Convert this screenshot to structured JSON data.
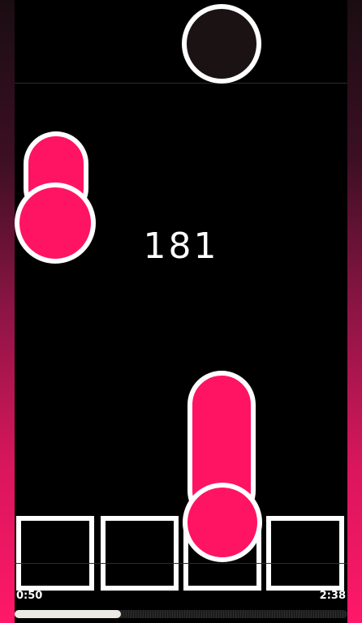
{
  "game": {
    "score": "181",
    "elapsed_time": "0:50",
    "total_time": "2:38",
    "progress": 0.32,
    "lanes": 4
  },
  "colors": {
    "note": "#ff1464",
    "note_outline": "#ffffff",
    "top_ball": "#1b1213",
    "background": "#000000",
    "gutter_bottom": "#ff1867"
  },
  "notes": [
    {
      "lane": 1,
      "type": "hold-note"
    },
    {
      "lane": 3,
      "type": "hold-note"
    }
  ]
}
